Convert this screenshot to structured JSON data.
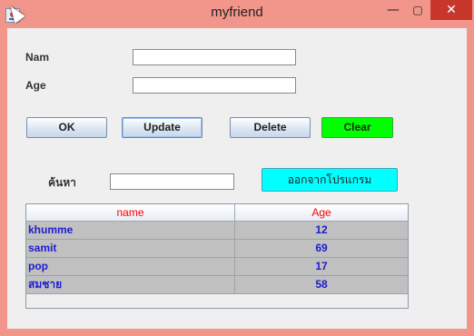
{
  "window": {
    "title": "myfriend",
    "controls": {
      "minimize": "—",
      "maximize": "▢",
      "close": "✕"
    }
  },
  "form": {
    "name_label": "Nam",
    "name_value": "",
    "age_label": "Age",
    "age_value": ""
  },
  "buttons": {
    "ok": "OK",
    "update": "Update",
    "delete": "Delete",
    "clear": "Clear",
    "exit": "ออกจากโปรแกรม"
  },
  "search": {
    "label": "ค้นหา",
    "value": ""
  },
  "table": {
    "columns": [
      "name",
      "Age"
    ],
    "rows": [
      {
        "name": "khumme",
        "age": "12"
      },
      {
        "name": "samit",
        "age": "69"
      },
      {
        "name": "pop",
        "age": "17"
      },
      {
        "name": "สมชาย",
        "age": "58"
      }
    ]
  },
  "colors": {
    "titlebar": "#f2958b",
    "header_text": "#ff0000",
    "cell_text": "#1c1ccf",
    "clear_button": "#00ff00",
    "exit_button": "#00ffff"
  }
}
